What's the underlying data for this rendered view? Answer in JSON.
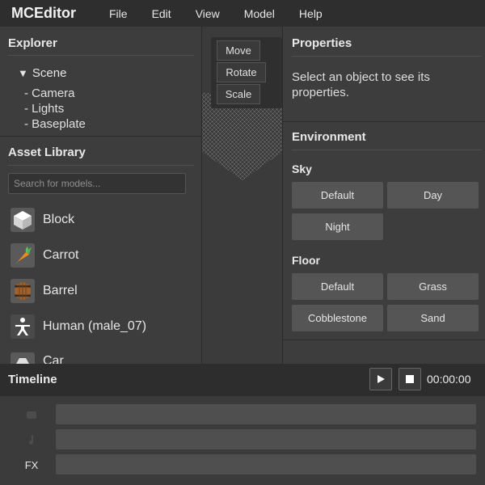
{
  "app": {
    "title": "MCEditor",
    "menu": [
      "File",
      "Edit",
      "View",
      "Model",
      "Help"
    ]
  },
  "explorer": {
    "title": "Explorer",
    "root": "Scene",
    "children": [
      "- Camera",
      "- Lights",
      "- Baseplate"
    ]
  },
  "asset_library": {
    "title": "Asset Library",
    "search_placeholder": "Search for models...",
    "items": [
      {
        "label": "Block",
        "icon": "cube-icon"
      },
      {
        "label": "Carrot",
        "icon": "carrot-icon"
      },
      {
        "label": "Barrel",
        "icon": "barrel-icon"
      },
      {
        "label": "Human (male_07)",
        "icon": "human-icon"
      },
      {
        "label": "Car",
        "icon": "car-icon"
      }
    ]
  },
  "tools": [
    "Move",
    "Rotate",
    "Scale"
  ],
  "properties": {
    "title": "Properties",
    "hint": "Select an object to see its properties."
  },
  "environment": {
    "title": "Environment",
    "sky": {
      "title": "Sky",
      "options": [
        "Default",
        "Day",
        "Night"
      ]
    },
    "floor": {
      "title": "Floor",
      "options": [
        "Default",
        "Grass",
        "Cobblestone",
        "Sand"
      ]
    }
  },
  "timeline": {
    "title": "Timeline",
    "time": "00:00:00",
    "tracks": [
      "",
      "",
      "FX"
    ]
  },
  "colors": {
    "menubar": "#2e2e2e",
    "panel": "#3d3d3d",
    "button": "#555555",
    "carrot": "#f08a1c"
  }
}
